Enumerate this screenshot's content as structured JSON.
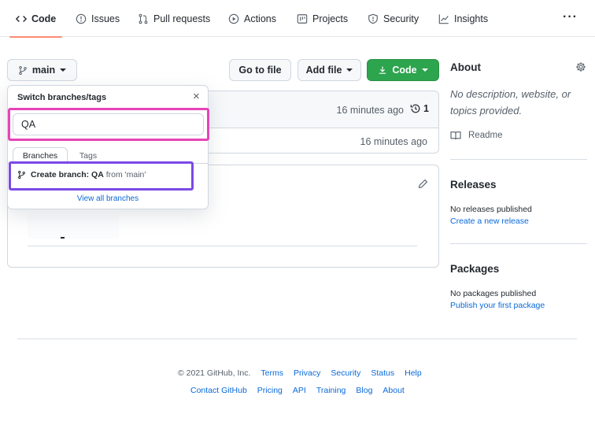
{
  "nav": {
    "tabs": [
      {
        "label": "Code",
        "icon": "code-icon",
        "active": true
      },
      {
        "label": "Issues",
        "icon": "issue-opened-icon"
      },
      {
        "label": "Pull requests",
        "icon": "git-pull-request-icon"
      },
      {
        "label": "Actions",
        "icon": "play-icon"
      },
      {
        "label": "Projects",
        "icon": "table-icon"
      },
      {
        "label": "Security",
        "icon": "shield-icon"
      },
      {
        "label": "Insights",
        "icon": "graph-icon"
      }
    ],
    "more": "···"
  },
  "toolbar": {
    "branch": "main",
    "go_to_file": "Go to file",
    "add_file": "Add file",
    "code": "Code"
  },
  "files": {
    "commit_time": "16 minutes ago",
    "history_count": "1",
    "row_time": "16 minutes ago"
  },
  "dropdown": {
    "title": "Switch branches/tags",
    "close": "×",
    "query": "QA",
    "tab_branches": "Branches",
    "tab_tags": "Tags",
    "create_prefix": "Create branch:",
    "create_name": "QA",
    "create_suffix": "from 'main'",
    "view_all": "View all branches"
  },
  "sidebar": {
    "about_title": "About",
    "about_desc": "No description, website, or topics provided.",
    "readme": "Readme",
    "releases_title": "Releases",
    "releases_none": "No releases published",
    "releases_link": "Create a new release",
    "packages_title": "Packages",
    "packages_none": "No packages published",
    "packages_link": "Publish your first package"
  },
  "footer": {
    "copyright": "© 2021 GitHub, Inc.",
    "row1": [
      "Terms",
      "Privacy",
      "Security",
      "Status",
      "Help"
    ],
    "row2": [
      "Contact GitHub",
      "Pricing",
      "API",
      "Training",
      "Blog",
      "About"
    ]
  },
  "colors": {
    "accent_underline": "#fd8c73",
    "green_button": "#2da44e",
    "link": "#0969da",
    "highlight_pink": "#e544b8",
    "highlight_purple": "#7b4ae6"
  }
}
